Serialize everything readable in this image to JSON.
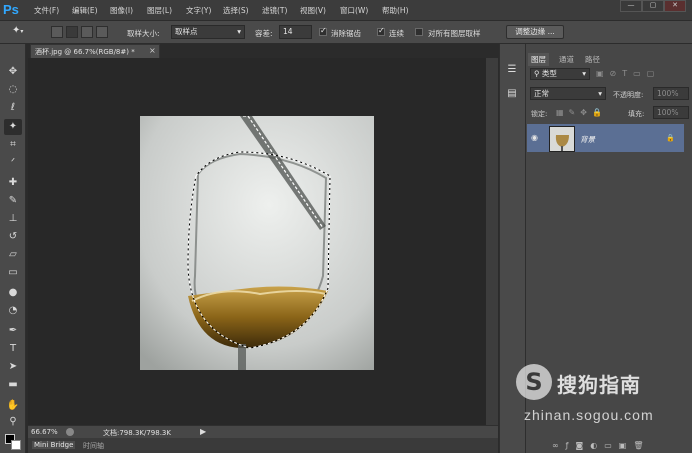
{
  "app": {
    "logo": "Ps"
  },
  "menu": [
    "文件(F)",
    "编辑(E)",
    "图像(I)",
    "图层(L)",
    "文字(Y)",
    "选择(S)",
    "滤镜(T)",
    "视图(V)",
    "窗口(W)",
    "帮助(H)"
  ],
  "window_buttons": {
    "minimize": "—",
    "restore": "▢",
    "close": "✕"
  },
  "options": {
    "sample_size_label": "取样大小:",
    "sample_size_value": "取样点",
    "tolerance_label": "容差:",
    "tolerance_value": "14",
    "antialias_label": "消除锯齿",
    "contiguous_label": "连续",
    "sample_all_label": "对所有图层取样",
    "refine_button": "调整边缘 ..."
  },
  "document": {
    "tab_title": "酒杯.jpg @ 66.7%(RGB/8#) *",
    "tab_close": "×",
    "zoom": "66.67%",
    "doc_info": "文档:798.3K/798.3K"
  },
  "bottom_tabs": [
    "Mini Bridge",
    "时间轴"
  ],
  "panels": {
    "tabs": [
      "图层",
      "通道",
      "路径"
    ],
    "filter_kind": "类型",
    "blend_mode": "正常",
    "opacity_label": "不透明度:",
    "opacity_value": "100%",
    "lock_label": "锁定:",
    "fill_label": "填充:",
    "fill_value": "100%",
    "layer_name": "背景"
  },
  "watermark": {
    "logo_letter": "S",
    "text": "搜狗指南",
    "url": "zhinan.sogou.com"
  },
  "colors": {
    "accent": "#31a8ff",
    "layer_selected": "#5b6f94",
    "panel_bg": "#474747"
  }
}
